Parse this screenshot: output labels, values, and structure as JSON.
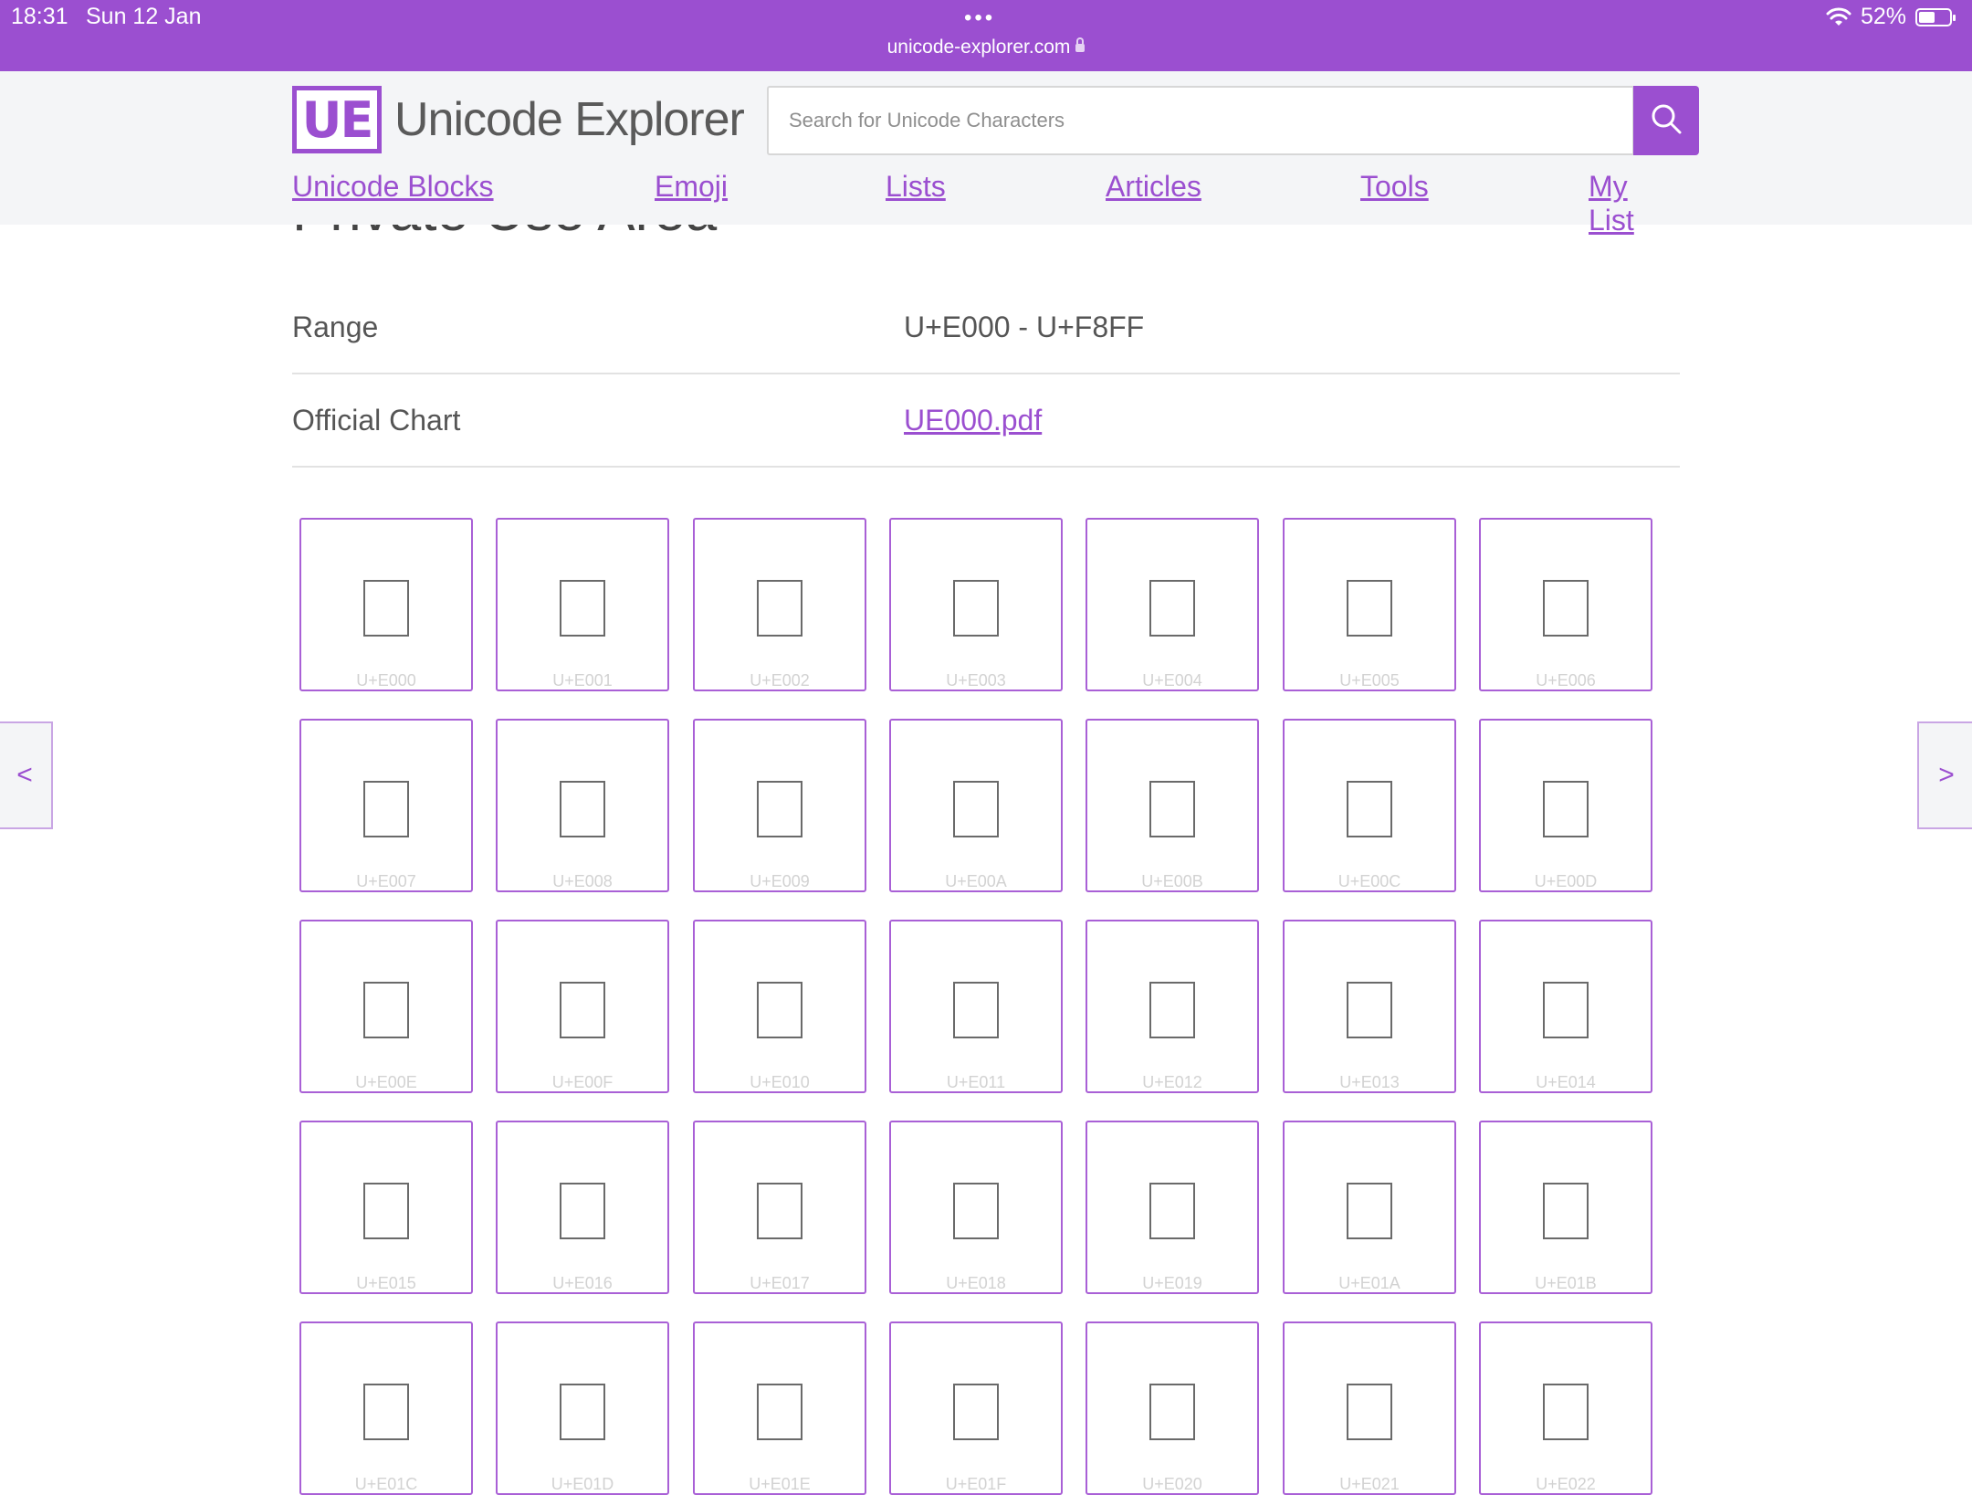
{
  "status_bar": {
    "time": "18:31",
    "date": "Sun 12 Jan",
    "battery": "52%",
    "battery_level": 0.52,
    "url": "unicode-explorer.com"
  },
  "header": {
    "logo_mark": "UE",
    "logo_text": "Unicode Explorer",
    "search_placeholder": "Search for Unicode Characters",
    "search_icon": "magnifier-icon"
  },
  "nav": {
    "items": [
      {
        "label": "Unicode Blocks"
      },
      {
        "label": "Emoji"
      },
      {
        "label": "Lists"
      },
      {
        "label": "Articles"
      },
      {
        "label": "Tools"
      },
      {
        "label": "My List"
      }
    ]
  },
  "block": {
    "title": "Private Use Area",
    "rows": [
      {
        "label": "Range",
        "value": "U+E000 - U+F8FF"
      },
      {
        "label": "Official Chart",
        "value": "UE000.pdf"
      }
    ]
  },
  "characters": [
    "U+E000",
    "U+E001",
    "U+E002",
    "U+E003",
    "U+E004",
    "U+E005",
    "U+E006",
    "U+E007",
    "U+E008",
    "U+E009",
    "U+E00A",
    "U+E00B",
    "U+E00C",
    "U+E00D",
    "U+E00E",
    "U+E00F",
    "U+E010",
    "U+E011",
    "U+E012",
    "U+E013",
    "U+E014",
    "U+E015",
    "U+E016",
    "U+E017",
    "U+E018",
    "U+E019",
    "U+E01A",
    "U+E01B",
    "U+E01C",
    "U+E01D",
    "U+E01E",
    "U+E01F",
    "U+E020",
    "U+E021",
    "U+E022"
  ],
  "pager": {
    "prev": "<",
    "next": ">"
  },
  "colors": {
    "accent": "#9b4fd0",
    "header_bg": "#f4f5f7"
  }
}
